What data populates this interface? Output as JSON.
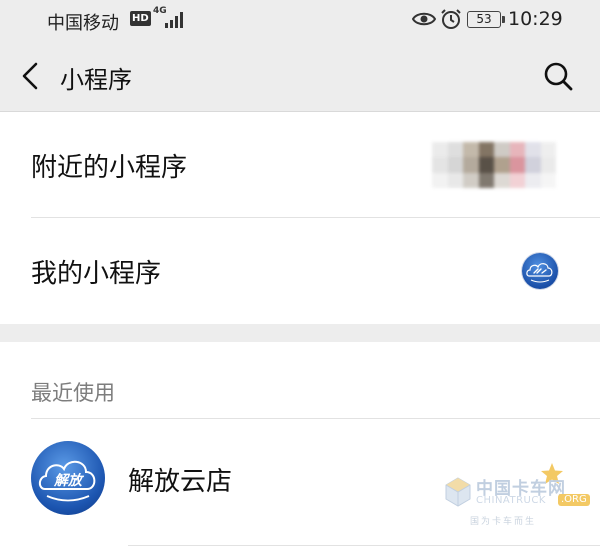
{
  "status_bar": {
    "carrier": "中国移动",
    "hd_badge": "HD",
    "network": "4G",
    "battery": "53",
    "time": "10:29"
  },
  "nav": {
    "title": "小程序",
    "back_icon": "chevron-left-icon",
    "search_icon": "search-icon"
  },
  "menu": {
    "nearby_label": "附近的小程序",
    "mine_label": "我的小程序"
  },
  "recent": {
    "header": "最近使用",
    "items": [
      {
        "name": "解放云店",
        "logo_text": "解放"
      }
    ]
  },
  "watermark": {
    "brand_cn": "中国卡车网",
    "brand_en": "CHINATRUCK",
    "suffix": ".ORG",
    "slogan": "国为卡车而生"
  },
  "colors": {
    "nav_background": "#ededed",
    "list_background": "#ffffff",
    "divider": "#e2e2e2",
    "logo_blue": "#1c55b0",
    "watermark_gold": "#f2c04a"
  }
}
